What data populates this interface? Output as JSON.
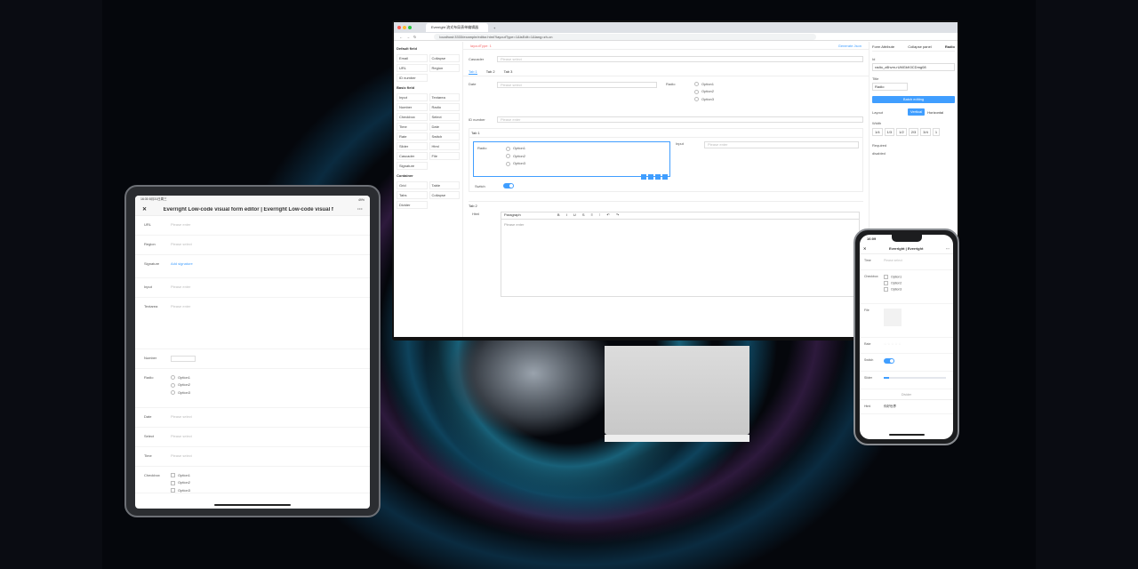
{
  "browser": {
    "tab_title": "Everright 流式布局表单编辑器",
    "url": "localhost:3333/example/editor.html?layoutType=1&isEdit=1&lang=zh-cn"
  },
  "designer": {
    "left_sections": [
      {
        "title": "Default field",
        "items": [
          "Email",
          "Collapse",
          "URL",
          "Region",
          "ID number"
        ]
      },
      {
        "title": "Basic field",
        "items": [
          "Input",
          "Textarea",
          "Number",
          "Radio",
          "Checkbox",
          "Select",
          "Time",
          "Date",
          "Rate",
          "Switch",
          "Slider",
          "Html",
          "Cascader",
          "File",
          "Signature"
        ]
      },
      {
        "title": "Container",
        "items": [
          "Grid",
          "Table",
          "Tabs",
          "Collapse",
          "Divider"
        ]
      }
    ],
    "toolbar": {
      "layout_label": "layoutType: 1",
      "generate_label": "Generate Json"
    },
    "canvas": {
      "cascader_label": "Cascader",
      "placeholder_select": "Please select",
      "placeholder_enter": "Please enter",
      "tabs": [
        "Tab 1",
        "Tab 2",
        "Tab 3"
      ],
      "date_label": "Date",
      "radio_label": "Radio",
      "options": [
        "Option1",
        "Option2",
        "Option3"
      ],
      "idnumber_label": "ID number",
      "tab1_label": "Tab 1",
      "input_label": "Input",
      "switch_label": "Switch",
      "tab2_label": "Tab 2",
      "html_label": "Html",
      "paragraph": "Paragraph",
      "html_placeholder": "Please enter"
    },
    "right": {
      "tabs": [
        "Form Attribute",
        "Collapse panel",
        "Radio"
      ],
      "id_label": "Id",
      "id_value": "radio_z8hvm-rUMGkK0CDmg08",
      "title_label": "Title",
      "title_value": "Radio",
      "add_entry": "Batch editing",
      "layout_label": "Layout",
      "layout_opts": [
        "Vertical",
        "Horizontal"
      ],
      "width_label": "Width",
      "widths": [
        "1/4",
        "1/3",
        "1/2",
        "2/3",
        "3/4",
        "1"
      ],
      "required": "Required",
      "disabled": "disabled"
    }
  },
  "tablet": {
    "status_time": "16:30",
    "status_date": "8月31日周三",
    "battery": "49%",
    "title": "Everright Low-code visual form editor | Everright Low-code visual f",
    "fields": [
      {
        "label": "URL",
        "placeholder": "Please enter"
      },
      {
        "label": "Region",
        "placeholder": "Please select"
      },
      {
        "label": "Signature",
        "placeholder": "Add signature"
      },
      {
        "label": "Input",
        "placeholder": "Please enter"
      },
      {
        "label": "Textarea",
        "placeholder": "Please enter"
      },
      {
        "label": "Number",
        "placeholder": ""
      },
      {
        "label": "Radio",
        "placeholder": ""
      },
      {
        "label": "Date",
        "placeholder": "Please select"
      },
      {
        "label": "Select",
        "placeholder": "Please select"
      },
      {
        "label": "Time",
        "placeholder": "Please select"
      },
      {
        "label": "Checkbox",
        "placeholder": ""
      }
    ],
    "options": [
      "Option1",
      "Option2",
      "Option3"
    ]
  },
  "phone": {
    "time": "16:09",
    "title": "Everright | Everright",
    "fields": [
      {
        "label": "Time",
        "placeholder": "Please select"
      },
      {
        "label": "Checkbox",
        "placeholder": ""
      },
      {
        "label": "File",
        "placeholder": ""
      },
      {
        "label": "Rate",
        "placeholder": ""
      },
      {
        "label": "Switch",
        "placeholder": ""
      },
      {
        "label": "Slider",
        "placeholder": ""
      },
      {
        "label": "Html",
        "placeholder": ""
      }
    ],
    "options": [
      "Option1",
      "Option2",
      "Option3"
    ],
    "divider": "Divider",
    "html_value": "你好世界"
  },
  "colors": {
    "accent": "#409eff",
    "background": "#05070c"
  }
}
